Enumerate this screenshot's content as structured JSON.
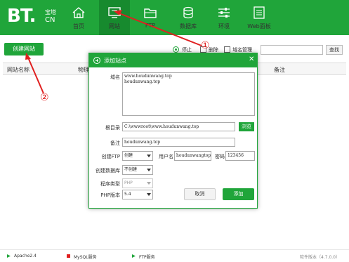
{
  "brand": {
    "logo": "BT.",
    "logo_cn_top": "宝塔",
    "logo_cn_bot": "CN"
  },
  "nav": [
    {
      "label": "首页",
      "icon": "home-icon"
    },
    {
      "label": "网站",
      "icon": "monitor-icon",
      "active": true
    },
    {
      "label": "FTP",
      "icon": "folder-icon"
    },
    {
      "label": "数据库",
      "icon": "database-icon"
    },
    {
      "label": "环境",
      "icon": "sliders-icon"
    },
    {
      "label": "Web面板",
      "icon": "panel-icon"
    }
  ],
  "toolbar": {
    "create_label": "创建网站",
    "stop_label": "停止",
    "delete_label": "删除",
    "domain_label": "域名管理",
    "search_placeholder": "",
    "search_label": "查找"
  },
  "table": {
    "headers": [
      "网站名称",
      "物理",
      "备注"
    ]
  },
  "modal": {
    "title": "添加站点",
    "domain_label": "域名",
    "domain_lines": [
      "www.houdunwang.top",
      "houdunwang.top"
    ],
    "root_label": "根目录",
    "root_value": "C:\\wwwroot\\www.houdunwang.top",
    "browse_label": "浏览",
    "remark_label": "备注",
    "remark_value": "houdunwang.top",
    "ftp_label": "创建FTP",
    "ftp_value": "创建",
    "ftp_user_label": "用户名",
    "ftp_user_value": "houdunwangtop",
    "ftp_pass_label": "密码",
    "ftp_pass_value": "123456",
    "db_label": "创建数据库",
    "db_value": "不创建",
    "prog_label": "程序类型",
    "prog_value": "PHP",
    "php_label": "PHP版本",
    "php_value": "5.4",
    "cancel_label": "取消",
    "add_label": "添加"
  },
  "footer": {
    "apache": "Apache2.4",
    "mysql": "MySQL服务",
    "ftp": "FTP服务",
    "version": "软件版本（4.7.0.0）"
  },
  "annotations": {
    "one": "①",
    "two": "②"
  },
  "colors": {
    "brand_green": "#20a53a",
    "active_green": "#178a2e",
    "annotation_red": "#e02020"
  }
}
